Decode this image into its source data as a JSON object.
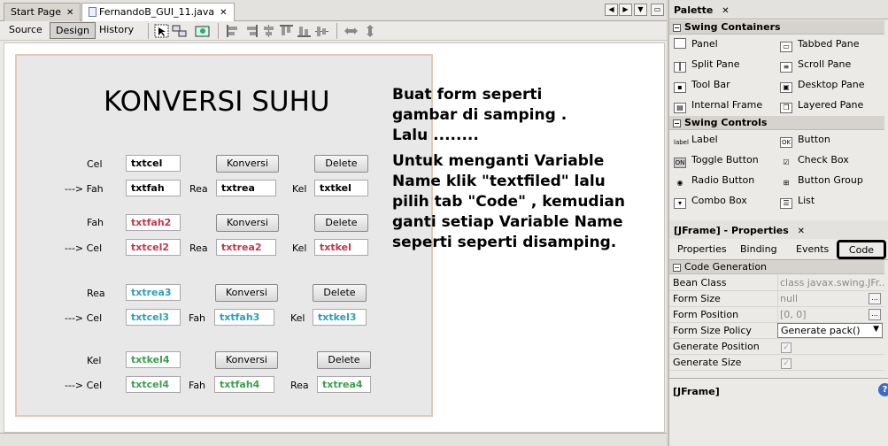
{
  "tabs": [
    {
      "label": "Start Page",
      "close": "✕"
    },
    {
      "label": "FernandoB_GUI_11.java",
      "close": "✕"
    }
  ],
  "toolbar": {
    "source": "Source",
    "design": "Design",
    "history": "History"
  },
  "form": {
    "title": "KONVERSI SUHU",
    "labels": {
      "cel1": "Cel",
      "fah_arrow": "---> Fah",
      "rea1": "Rea",
      "kel1": "Kel",
      "fah2": "Fah",
      "cel_arrow2": "---> Cel",
      "rea2": "Rea",
      "kel2": "Kel",
      "rea3": "Rea",
      "cel_arrow3": "---> Cel",
      "fah3": "Fah",
      "kel3": "Kel",
      "kel4": "Kel",
      "cel_arrow4": "---> Cel",
      "fah4": "Fah",
      "rea4": "Rea"
    },
    "fields": {
      "txtcel": "txtcel",
      "txtfah": "txtfah",
      "txtrea": "txtrea",
      "txtkel": "txtkel",
      "txtfah2": "txtfah2",
      "txtcel2": "txtcel2",
      "txtrea2": "txtrea2",
      "txtkel2": "txtkel",
      "txtrea3": "txtrea3",
      "txtcel3": "txtcel3",
      "txtfah3": "txtfah3",
      "txtkel3": "txtkel3",
      "txtkel4": "txtkel4",
      "txtcel4": "txtcel4",
      "txtfah4": "txtfah4",
      "txtrea4": "txtrea4"
    },
    "konversi": "Konversi",
    "delete": "Delete"
  },
  "note": {
    "line1": "Buat form seperti",
    "line2": "gambar di samping .",
    "line3": "Lalu ........",
    "line4": "Untuk menganti Variable",
    "line5": "Name klik \"textfiled\" lalu",
    "line6": "pilih tab \"Code\" , kemudian",
    "line7": "ganti setiap Variable Name",
    "line8": "seperti seperti disamping."
  },
  "palette": {
    "title": "Palette",
    "close": "✕",
    "containers_header": "Swing Containers",
    "containers": [
      "Panel",
      "Tabbed Pane",
      "Split Pane",
      "Scroll Pane",
      "Tool Bar",
      "Desktop Pane",
      "Internal Frame",
      "Layered Pane"
    ],
    "controls_header": "Swing Controls",
    "controls": [
      "Label",
      "Button",
      "Toggle Button",
      "Check Box",
      "Radio Button",
      "Button Group",
      "Combo Box",
      "List"
    ]
  },
  "properties": {
    "title": "[JFrame] - Properties",
    "close": "✕",
    "tabs": [
      "Properties",
      "Binding",
      "Events",
      "Code"
    ],
    "section": "Code Generation",
    "rows": [
      {
        "key": "Bean Class",
        "value": "class javax.swing.JFr..."
      },
      {
        "key": "Form Size",
        "value": "null"
      },
      {
        "key": "Form Position",
        "value": "[0, 0]"
      },
      {
        "key": "Form Size Policy",
        "value": "Generate pack()"
      },
      {
        "key": "Generate Position",
        "value": "✓"
      },
      {
        "key": "Generate Size",
        "value": "✓"
      }
    ],
    "footer": "[JFrame]",
    "help": "?"
  },
  "colors": {
    "highlight_border": "#000000",
    "field_red": "#c0384a",
    "field_blue": "#2aa0b8",
    "field_green": "#3aa050"
  }
}
